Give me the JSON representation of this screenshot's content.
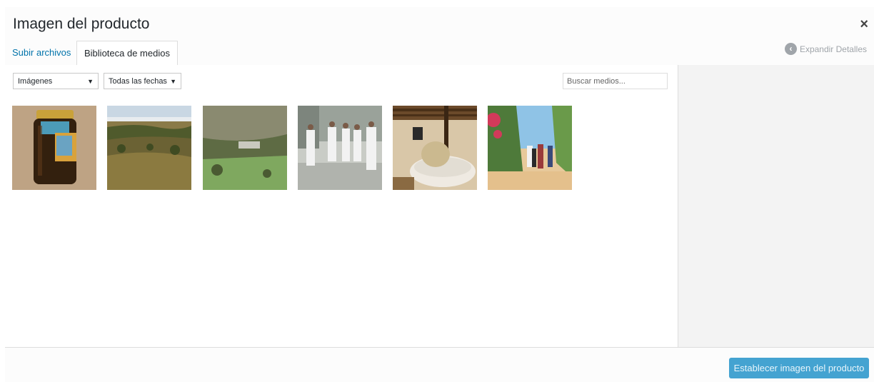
{
  "modal": {
    "title": "Imagen del producto",
    "close_label": "×"
  },
  "tabs": [
    {
      "label": "Subir archivos",
      "active": false
    },
    {
      "label": "Biblioteca de medios",
      "active": true
    }
  ],
  "sidebar": {
    "expand_label": "Expandir Detalles",
    "expand_icon": "chevron-left-circle-icon"
  },
  "filters": {
    "type_value": "Imágenes",
    "date_value": "Todas las fechas",
    "arrow": "▼"
  },
  "search": {
    "placeholder": "Buscar medios..."
  },
  "attachments": [
    {
      "subject": "honey jar"
    },
    {
      "subject": "landscape hills"
    },
    {
      "subject": "green valley"
    },
    {
      "subject": "people in lab coats"
    },
    {
      "subject": "stone mill"
    },
    {
      "subject": "group walking path"
    }
  ],
  "toolbar": {
    "primary_label": "Establecer imagen del producto"
  },
  "colors": {
    "accent": "#0073aa",
    "primary_button": "#44a3d1",
    "sidebar_bg": "#f3f3f3"
  }
}
